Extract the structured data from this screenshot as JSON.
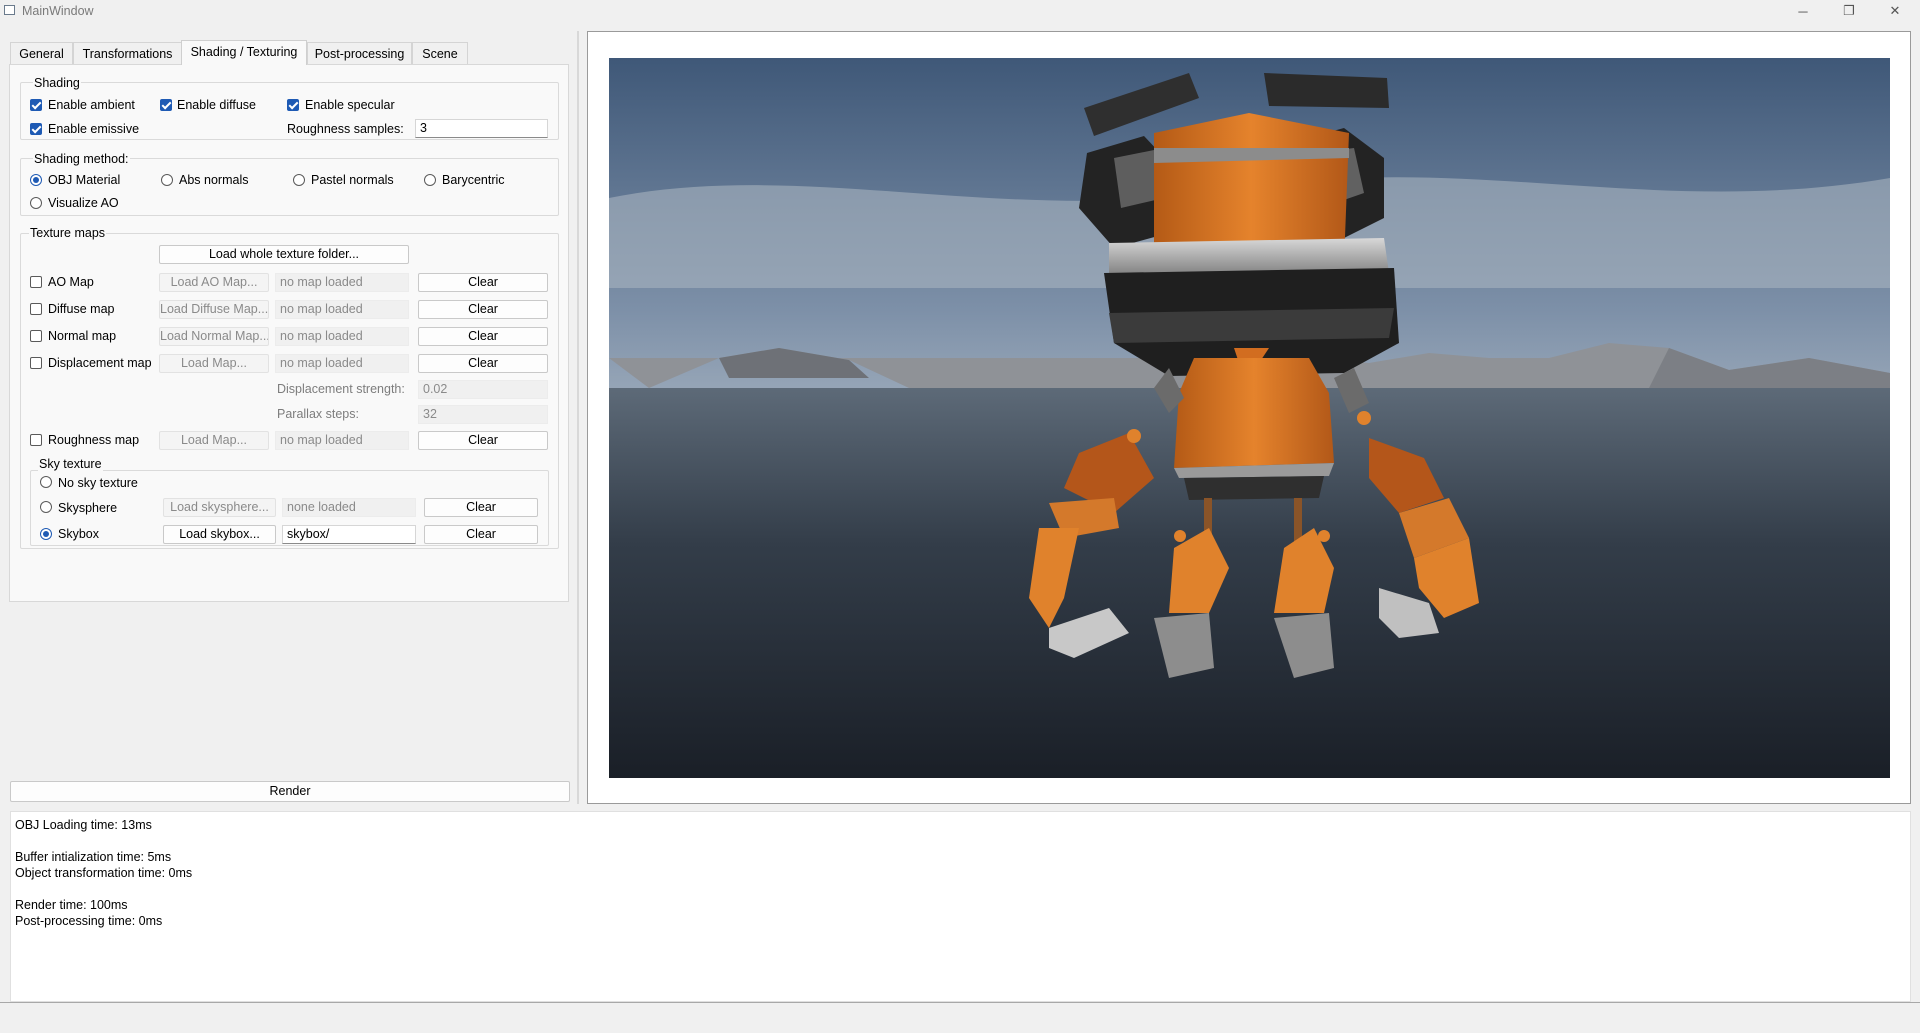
{
  "window": {
    "title": "MainWindow",
    "controls": {
      "minimize": "─",
      "maximize": "❐",
      "close": "✕"
    }
  },
  "tabs": [
    "General",
    "Transformations",
    "Shading / Texturing",
    "Post-processing",
    "Scene"
  ],
  "active_tab": "Shading / Texturing",
  "shading": {
    "title": "Shading",
    "enable_ambient": {
      "label": "Enable ambient",
      "checked": true
    },
    "enable_diffuse": {
      "label": "Enable diffuse",
      "checked": true
    },
    "enable_specular": {
      "label": "Enable specular",
      "checked": true
    },
    "enable_emissive": {
      "label": "Enable emissive",
      "checked": true
    },
    "roughness_label": "Roughness samples:",
    "roughness_value": "3"
  },
  "shading_method": {
    "title": "Shading method:",
    "options": [
      "OBJ Material",
      "Abs normals",
      "Pastel normals",
      "Barycentric",
      "Visualize AO"
    ],
    "selected": "OBJ Material"
  },
  "texture_maps": {
    "title": "Texture maps",
    "load_folder": "Load whole texture folder...",
    "maps": [
      {
        "label": "AO Map",
        "load": "Load AO Map...",
        "status": "no map loaded",
        "clear": "Clear"
      },
      {
        "label": "Diffuse map",
        "load": "Load Diffuse Map...",
        "status": "no map loaded",
        "clear": "Clear"
      },
      {
        "label": "Normal map",
        "load": "Load Normal Map...",
        "status": "no map loaded",
        "clear": "Clear"
      },
      {
        "label": "Displacement map",
        "load": "Load Map...",
        "status": "no map loaded",
        "clear": "Clear"
      }
    ],
    "displacement_strength_label": "Displacement strength:",
    "displacement_strength_value": "0.02",
    "parallax_steps_label": "Parallax steps:",
    "parallax_steps_value": "32",
    "roughness_map": {
      "label": "Roughness map",
      "load": "Load Map...",
      "status": "no map loaded",
      "clear": "Clear"
    }
  },
  "sky_texture": {
    "title": "Sky texture",
    "no_sky": "No sky texture",
    "skysphere": {
      "label": "Skysphere",
      "load": "Load skysphere...",
      "status": "none loaded",
      "clear": "Clear"
    },
    "skybox": {
      "label": "Skybox",
      "load": "Load skybox...",
      "value": "skybox/",
      "clear": "Clear"
    },
    "selected": "Skybox"
  },
  "render_button": "Render",
  "log": [
    "OBJ Loading time: 13ms",
    "",
    "Buffer intialization time: 5ms",
    "Object transformation time: 0ms",
    "",
    "Render time: 100ms",
    "Post-processing time: 0ms"
  ],
  "colors": {
    "accent": "#1e5ab4",
    "robot_orange": "#e07a24",
    "robot_dark": "#2e2e2e"
  }
}
